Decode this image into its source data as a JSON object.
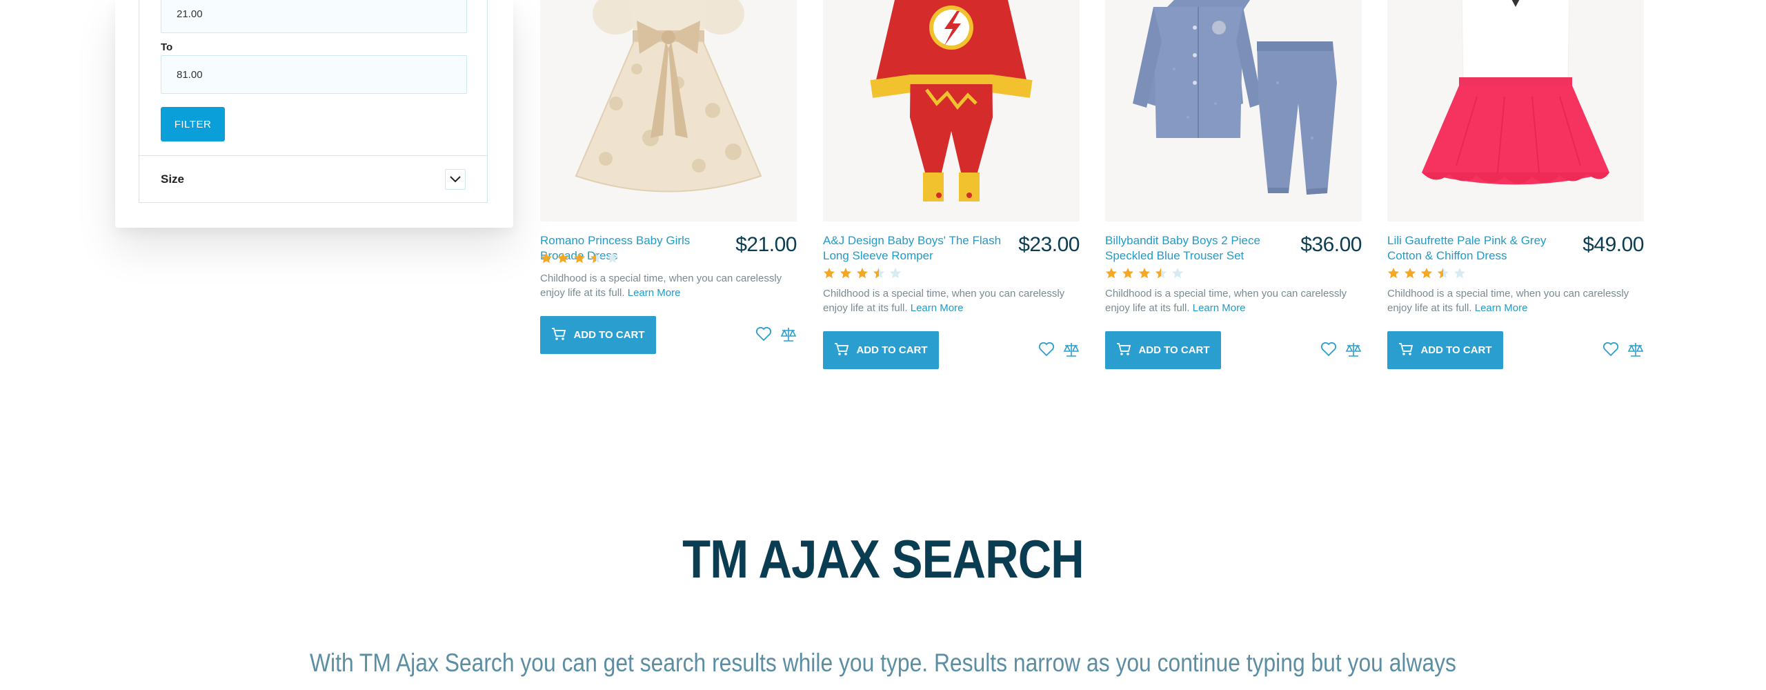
{
  "filter": {
    "from_value": "21.00",
    "to_label": "To",
    "to_value": "81.00",
    "filter_button": "FILTER",
    "size_label": "Size"
  },
  "products": [
    {
      "name": "Romano Princess Baby Girls Brocade Dress",
      "price": "$21.00",
      "rating": 3.5,
      "description": "Childhood is a special time, when you can carelessly enjoy life at its full.",
      "learn_more": "Learn More",
      "add_to_cart": "ADD TO CART"
    },
    {
      "name": "A&J Design Baby Boys' The Flash Long Sleeve Romper",
      "price": "$23.00",
      "rating": 3.5,
      "description": "Childhood is a special time, when you can carelessly enjoy life at its full.",
      "learn_more": "Learn More",
      "add_to_cart": "ADD TO CART"
    },
    {
      "name": "Billybandit Baby Boys 2 Piece Speckled Blue Trouser Set",
      "price": "$36.00",
      "rating": 3.5,
      "description": "Childhood is a special time, when you can carelessly enjoy life at its full.",
      "learn_more": "Learn More",
      "add_to_cart": "ADD TO CART"
    },
    {
      "name": "Lili Gaufrette Pale Pink & Grey Cotton & Chiffon Dress",
      "price": "$49.00",
      "rating": 3.5,
      "description": "Childhood is a special time, when you can carelessly enjoy life at its full.",
      "learn_more": "Learn More",
      "add_to_cart": "ADD TO CART"
    }
  ],
  "section": {
    "title": "TM AJAX SEARCH",
    "text": "With TM Ajax Search you can get search results while you type. Results narrow as you continue typing but you always"
  },
  "colors": {
    "accent": "#2a9fcf",
    "filter_button": "#0a9fd8",
    "heading": "#0b3d52",
    "link": "#1f9bc9",
    "star_filled": "#f5a623",
    "star_empty": "#d7ebf2"
  }
}
